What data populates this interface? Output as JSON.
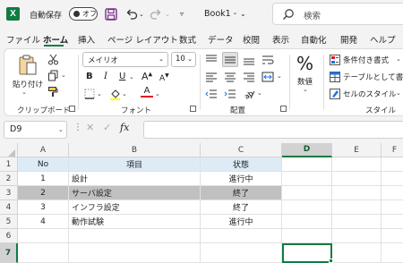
{
  "titlebar": {
    "app_logo": "X",
    "autosave_label": "自動保存",
    "autosave_state": "オフ",
    "book_title": "Book1",
    "book_title_suffix": "-",
    "search_placeholder": "検索"
  },
  "tabs": [
    "ファイル",
    "ホーム",
    "挿入",
    "ページ レイアウト",
    "数式",
    "データ",
    "校閲",
    "表示",
    "自動化",
    "開発",
    "ヘルプ"
  ],
  "ribbon": {
    "clipboard": {
      "paste_label": "貼り付け",
      "group_label": "クリップボード"
    },
    "font": {
      "font_name": "メイリオ",
      "font_size": "10",
      "group_label": "フォント",
      "bold": "B",
      "italic": "I",
      "underline": "U",
      "grow": "A",
      "shrink": "A",
      "font_color": "A",
      "font_color_value": "#e81123"
    },
    "alignment": {
      "group_label": "配置"
    },
    "number": {
      "label": "数値",
      "symbol": "%"
    },
    "styles": {
      "conditional_formatting": "条件付き書式",
      "format_as_table": "テーブルとして書式設",
      "cell_styles": "セルのスタイル",
      "group_label": "スタイル"
    }
  },
  "formula_bar": {
    "name_box": "D9",
    "cancel": "✕",
    "enter": "✓",
    "fx": "fx",
    "content": ""
  },
  "grid": {
    "columns": [
      "A",
      "B",
      "C",
      "D",
      "E",
      "F"
    ],
    "selected_column": "D",
    "rows": [
      "1",
      "2",
      "3",
      "4",
      "5",
      "6",
      "7"
    ],
    "selected_row": "7",
    "header": {
      "no": "No",
      "item": "項目",
      "status": "状態"
    },
    "data": [
      {
        "no": "1",
        "item": "設計",
        "status": "進行中"
      },
      {
        "no": "2",
        "item": "サーバ設定",
        "status": "終了"
      },
      {
        "no": "3",
        "item": "インフラ設定",
        "status": "終了"
      },
      {
        "no": "4",
        "item": "動作試験",
        "status": "進行中"
      }
    ],
    "header_fill": "#ddebf7",
    "done_fill": "#c0c0c0"
  }
}
